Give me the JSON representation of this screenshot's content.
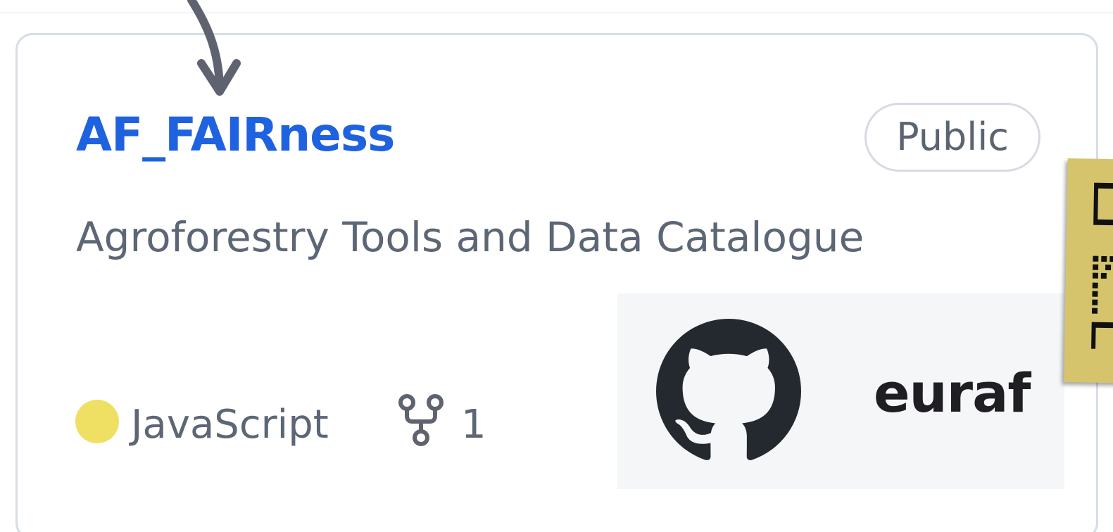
{
  "repo": {
    "name": "AF_FAIRness",
    "visibility": "Public",
    "description": "Agroforestry Tools and Data Catalogue",
    "language": "JavaScript",
    "language_color": "#efdf63",
    "forks": "1"
  },
  "github_panel": {
    "org_name": "euraf",
    "icon": "github-octocat-icon"
  },
  "colors": {
    "link": "#1f62e0",
    "muted_text": "#5c6675",
    "border": "#d7dde5",
    "panel_bg": "#f5f6f8",
    "sticky_note": "#d6c46d"
  }
}
